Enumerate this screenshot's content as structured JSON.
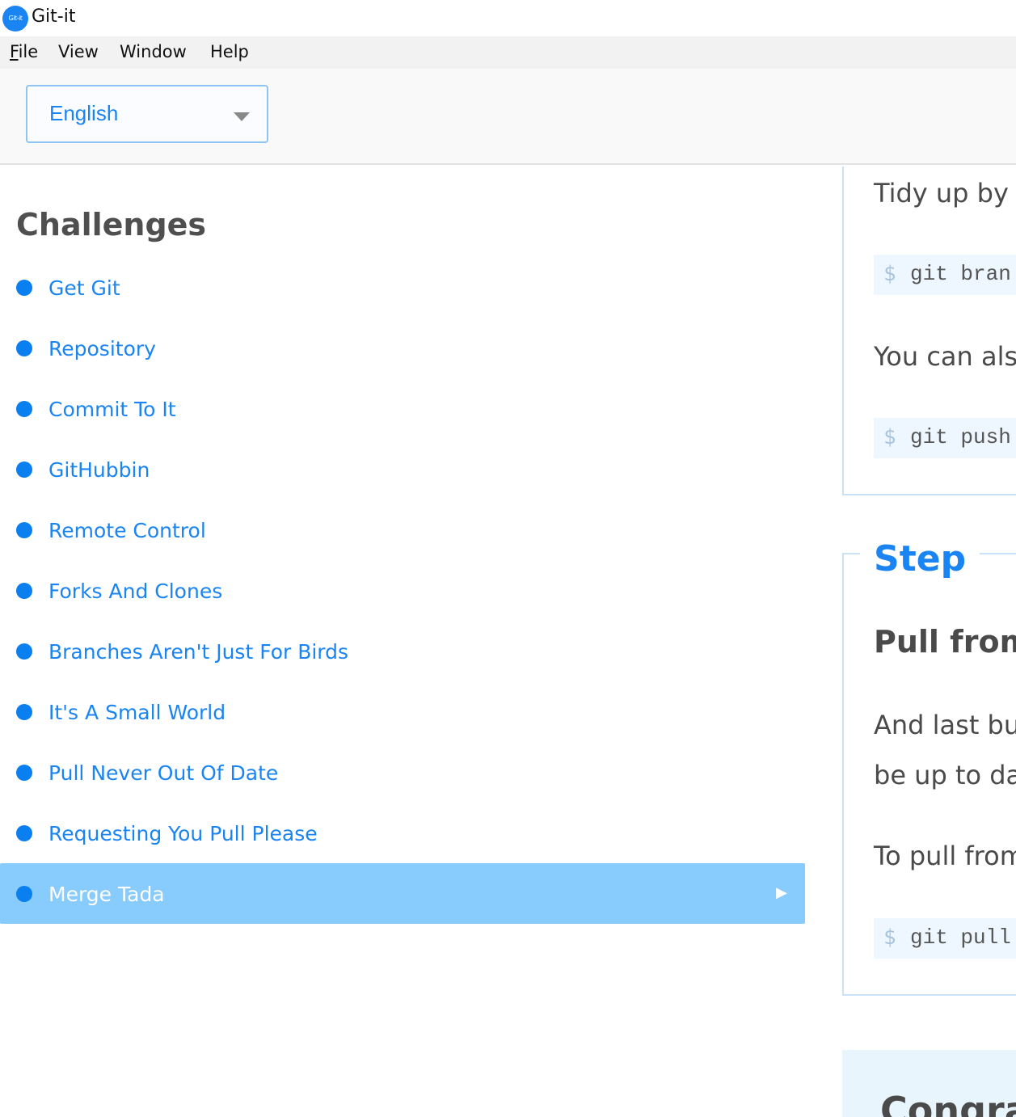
{
  "window": {
    "app_icon_text": "Git-it",
    "title": "Git-it"
  },
  "menu": {
    "file": "File",
    "view": "View",
    "window": "Window",
    "help": "Help"
  },
  "language": {
    "selected": "English"
  },
  "sidebar": {
    "title": "Challenges",
    "items": [
      {
        "label": "Get Git"
      },
      {
        "label": "Repository"
      },
      {
        "label": "Commit To It"
      },
      {
        "label": "GitHubbin"
      },
      {
        "label": "Remote Control"
      },
      {
        "label": "Forks And Clones"
      },
      {
        "label": "Branches Aren't Just For Birds"
      },
      {
        "label": "It's A Small World"
      },
      {
        "label": "Pull Never Out Of Date"
      },
      {
        "label": "Requesting You Pull Please"
      },
      {
        "label": "Merge Tada",
        "active": true
      }
    ],
    "active_arrow": "▶"
  },
  "content": {
    "box1": {
      "text1": "Tidy up by d",
      "code1_prompt": "$",
      "code1_cmd": "git bran",
      "text2": "You can also",
      "code2_prompt": "$",
      "code2_cmd": "git push"
    },
    "box2": {
      "step_title": "Step",
      "heading": "Pull from",
      "para_line1": "And last but",
      "para_line2": "be up to dat",
      "text3": "To pull from",
      "code_prompt": "$",
      "code_cmd": "git pull"
    },
    "congrats": "Congra"
  },
  "colors": {
    "accent": "#1a84f2",
    "active_row": "#88cbfd",
    "dot": "#0a7fef",
    "code_bg": "#eef7ff",
    "box_border": "#c9e2f8"
  }
}
